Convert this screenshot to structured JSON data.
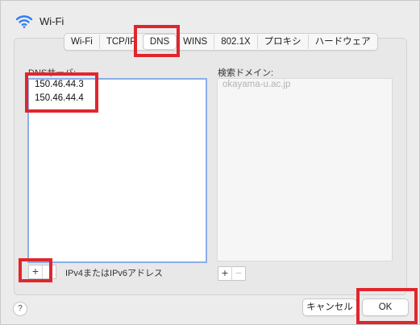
{
  "window": {
    "title": "Wi-Fi"
  },
  "tabs": [
    {
      "label": "Wi-Fi"
    },
    {
      "label": "TCP/IP"
    },
    {
      "label": "DNS"
    },
    {
      "label": "WINS"
    },
    {
      "label": "802.1X"
    },
    {
      "label": "プロキシ"
    },
    {
      "label": "ハードウェア"
    }
  ],
  "selected_tab": "DNS",
  "dns": {
    "label": "DNSサーバ:",
    "servers": [
      "150.46.44.3",
      "150.46.44.4"
    ],
    "add": "+",
    "hint": "IPv4またはIPv6アドレス"
  },
  "domains": {
    "label": "検索ドメイン:",
    "items": [
      "okayama-u.ac.jp"
    ],
    "add": "+",
    "remove": "−"
  },
  "footer": {
    "help": "?",
    "cancel": "キャンセル",
    "ok": "OK"
  },
  "colors": {
    "highlight": "#e0262d",
    "focus": "#8aaee8",
    "wifi": "#2f7ff5"
  }
}
